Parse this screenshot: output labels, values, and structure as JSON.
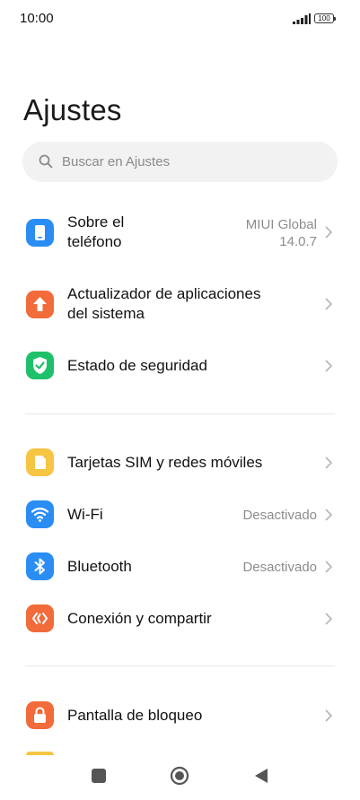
{
  "status": {
    "time": "10:00",
    "battery": "100"
  },
  "page_title": "Ajustes",
  "search": {
    "placeholder": "Buscar en Ajustes"
  },
  "items": [
    {
      "label_line1": "Sobre el",
      "label_line2": "teléfono",
      "value_line1": "MIUI Global",
      "value_line2": "14.0.7",
      "icon": "phone-icon",
      "color": "#2a8df4"
    },
    {
      "label_line1": "Actualizador de aplicaciones",
      "label_line2": "del sistema",
      "icon": "arrow-up-icon",
      "color": "#f26b3a"
    },
    {
      "label": "Estado de seguridad",
      "icon": "shield-check-icon",
      "color": "#1fc06a"
    },
    {
      "label": "Tarjetas SIM y redes móviles",
      "icon": "sim-card-icon",
      "color": "#f7c544"
    },
    {
      "label": "Wi-Fi",
      "value": "Desactivado",
      "icon": "wifi-icon",
      "color": "#2a8df4"
    },
    {
      "label": "Bluetooth",
      "value": "Desactivado",
      "icon": "bluetooth-icon",
      "color": "#2a8df4"
    },
    {
      "label": "Conexión y compartir",
      "icon": "connection-share-icon",
      "color": "#f26b3a"
    },
    {
      "label": "Pantalla de bloqueo",
      "icon": "lock-icon",
      "color": "#f26b3a"
    }
  ],
  "navbar": {
    "buttons": [
      "recents-icon",
      "home-icon",
      "back-icon"
    ]
  }
}
